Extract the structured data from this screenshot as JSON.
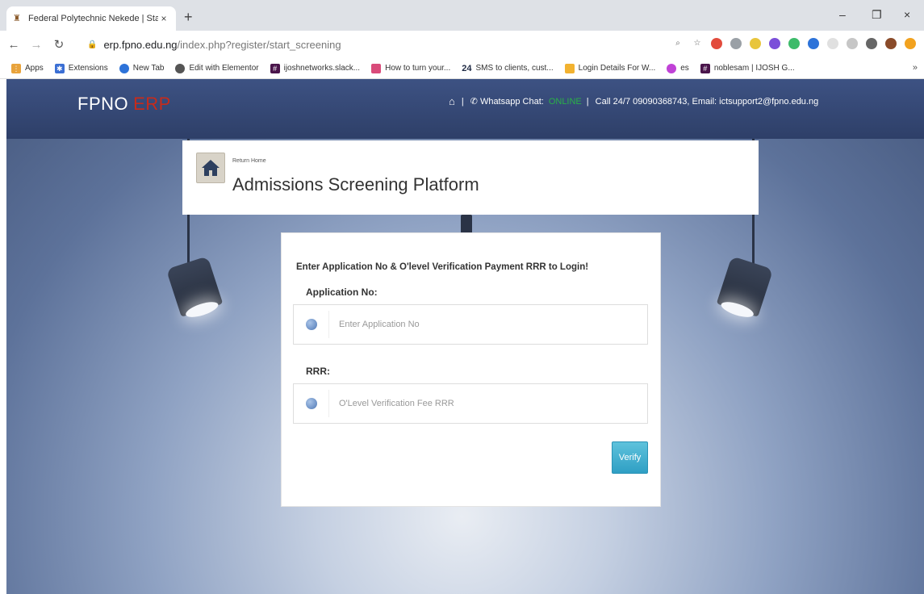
{
  "browser": {
    "tab_title": "Federal Polytechnic Nekede | Sta",
    "tab_close": "×",
    "new_tab": "+",
    "url_domain": "erp.fpno.edu.ng",
    "url_path": "/index.php?register/start_screening",
    "window_controls": [
      "–",
      "❐",
      "×"
    ]
  },
  "bookmarks": [
    {
      "label": "Apps",
      "color": "#e8a33c"
    },
    {
      "label": "Extensions",
      "color": "#3b6fd4"
    },
    {
      "label": "New Tab",
      "color": "#2d73d9"
    },
    {
      "label": "Edit with Elementor",
      "color": "#555555"
    },
    {
      "label": "ijoshnetworks.slack...",
      "color": "#4a154b"
    },
    {
      "label": "How to turn your...",
      "color": "#d94b7a"
    },
    {
      "label": "SMS to clients, cust...",
      "color": "#1f6fd6",
      "prefix": "24"
    },
    {
      "label": "Login Details For W...",
      "color": "#f2b230"
    },
    {
      "label": "es",
      "color": "#c042d6"
    },
    {
      "label": "noblesam | IJOSH G...",
      "color": "#4a154b"
    }
  ],
  "bookmarks_more": "»",
  "site": {
    "brand": "FPNO",
    "brand_accent": "ERP",
    "whatsapp_label": "Whatsapp Chat:",
    "online": "ONLINE",
    "contact": "Call 24/7  09090368743, Email: ictsupport2@fpno.edu.ng",
    "separator": "|"
  },
  "header": {
    "return_home": "Return Home",
    "title": "Admissions Screening Platform"
  },
  "login": {
    "instruction": "Enter Application No & O'level Verification Payment RRR to Login!",
    "app_no_label": "Application No:",
    "app_no_placeholder": "Enter Application No",
    "app_no_value": "",
    "rrr_label": "RRR:",
    "rrr_placeholder": "O'Level Verification Fee RRR",
    "rrr_value": "",
    "verify_label": "Verify"
  },
  "colors": {
    "nav_bg": "#34487a",
    "accent_red": "#c72b1b",
    "online_green": "#2ab048",
    "verify_btn": "#3fb0d2"
  }
}
